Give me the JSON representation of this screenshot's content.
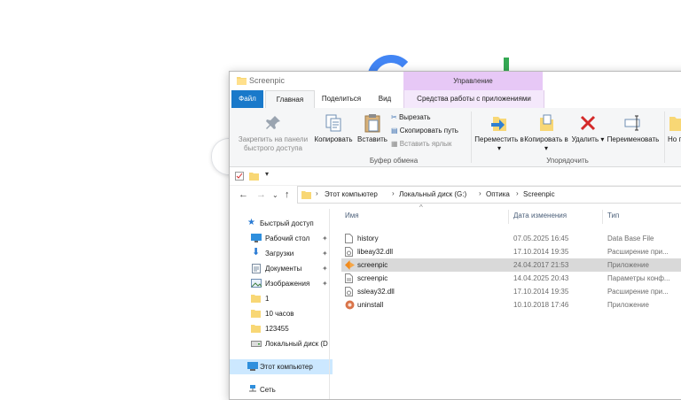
{
  "window": {
    "title": "Screenpic"
  },
  "ribbon": {
    "context_header": "Управление",
    "tabs": {
      "file": "Файл",
      "home": "Главная",
      "share": "Поделиться",
      "view": "Вид",
      "context": "Средства работы с приложениями"
    },
    "pin_quick_access": "Закрепить на панели быстрого доступа",
    "copy": "Копировать",
    "paste": "Вставить",
    "cut": "Вырезать",
    "copy_path": "Скопировать путь",
    "paste_shortcut": "Вставить ярлык",
    "clipboard_group": "Буфер обмена",
    "move_to": "Переместить в",
    "copy_to": "Копировать в",
    "delete": "Удалить",
    "rename": "Переименовать",
    "organize_group": "Упорядочить",
    "new_partial": "Но па"
  },
  "address": {
    "crumbs": [
      "Этот компьютер",
      "Локальный диск (G:)",
      "Оптика",
      "Screenpic"
    ]
  },
  "nav": {
    "quick_access": "Быстрый доступ",
    "items": [
      {
        "label": "Рабочий стол",
        "icon": "desktop-icon",
        "pinned": true
      },
      {
        "label": "Загрузки",
        "icon": "download-icon",
        "pinned": true
      },
      {
        "label": "Документы",
        "icon": "documents-icon",
        "pinned": true
      },
      {
        "label": "Изображения",
        "icon": "pictures-icon",
        "pinned": true
      },
      {
        "label": "1",
        "icon": "folder-icon",
        "pinned": false
      },
      {
        "label": "10 часов",
        "icon": "folder-icon",
        "pinned": false
      },
      {
        "label": "123455",
        "icon": "folder-icon",
        "pinned": false
      },
      {
        "label": "Локальный диск (D",
        "icon": "drive-icon",
        "pinned": false
      }
    ],
    "this_pc": "Этот компьютер",
    "network": "Сеть",
    "pin_glyph": "✦"
  },
  "columns": {
    "name": "Имя",
    "date": "Дата изменения",
    "type": "Тип"
  },
  "files": [
    {
      "name": "history",
      "date": "07.05.2025 16:45",
      "type": "Data Base File",
      "icon": "file-icon"
    },
    {
      "name": "libeay32.dll",
      "date": "17.10.2014 19:35",
      "type": "Расширение при...",
      "icon": "dll-icon"
    },
    {
      "name": "screenpic",
      "date": "24.04.2017 21:53",
      "type": "Приложение",
      "icon": "app-icon",
      "selected": true
    },
    {
      "name": "screenpic",
      "date": "14.04.2025 20:43",
      "type": "Параметры конф...",
      "icon": "config-icon"
    },
    {
      "name": "ssleay32.dll",
      "date": "17.10.2014 19:35",
      "type": "Расширение при...",
      "icon": "dll-icon"
    },
    {
      "name": "uninstall",
      "date": "10.10.2018 17:46",
      "type": "Приложение",
      "icon": "uninstall-icon"
    }
  ]
}
